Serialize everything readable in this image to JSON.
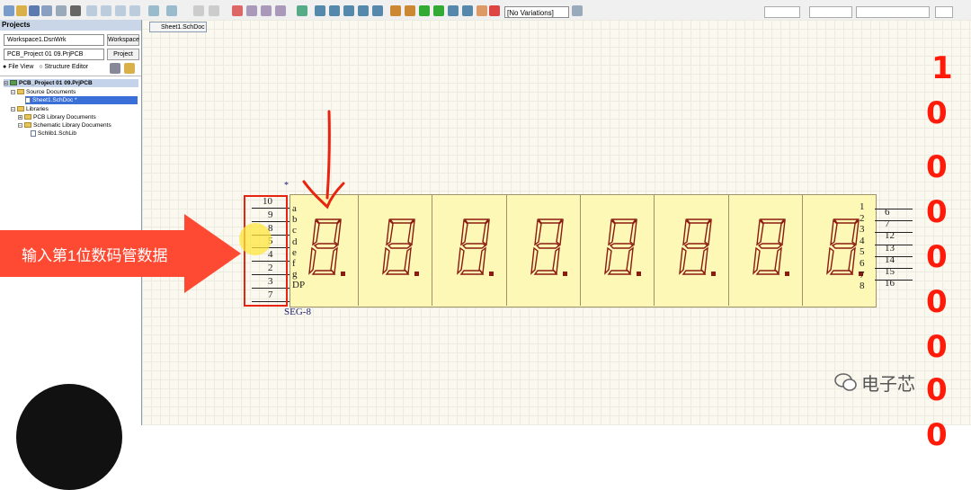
{
  "toolbar": {
    "variations_label": "[No Variations]"
  },
  "panel": {
    "title": "Projects",
    "workspace_value": "Workspace1.DsnWrk",
    "workspace_button": "Workspace",
    "project_value": "PCB_Project 01 09.PrjPCB",
    "project_button": "Project",
    "view_file": "File View",
    "view_structure": "Structure Editor",
    "tree": {
      "project": "PCB_Project 01 09.PrjPCB",
      "source_documents": "Source Documents",
      "sheet": "Sheet1.SchDoc *",
      "libraries": "Libraries",
      "pcb_library_documents": "PCB Library Documents",
      "schematic_library_documents": "Schematic Library Documents",
      "schlib": "Schlib1.SchLib"
    }
  },
  "document_tab": {
    "label": "Sheet1.SchDoc"
  },
  "component": {
    "designator_marker": "*",
    "name": "SEG-8",
    "left_pins": [
      "10",
      "9",
      "8",
      "5",
      "4",
      "2",
      "3",
      "7"
    ],
    "segment_labels": [
      "a",
      "b",
      "c",
      "d",
      "e",
      "f",
      "g",
      "DP"
    ],
    "right_pins": [
      "6",
      "7",
      "12",
      "13",
      "14",
      "15",
      "16"
    ],
    "right_labels": [
      "1",
      "2",
      "3",
      "4",
      "5",
      "6",
      "7",
      "8"
    ],
    "digit_count": 8
  },
  "annotation": {
    "text": "输入第1位数码管数据"
  },
  "side_digits": [
    "1",
    "0",
    "0",
    "0",
    "0",
    "0",
    "0",
    "0",
    "0"
  ],
  "watermark": {
    "text": "电子芯"
  },
  "colors": {
    "accent": "#ff1a0a",
    "annotation": "#ff4a33",
    "segment": "#8b1a10"
  }
}
